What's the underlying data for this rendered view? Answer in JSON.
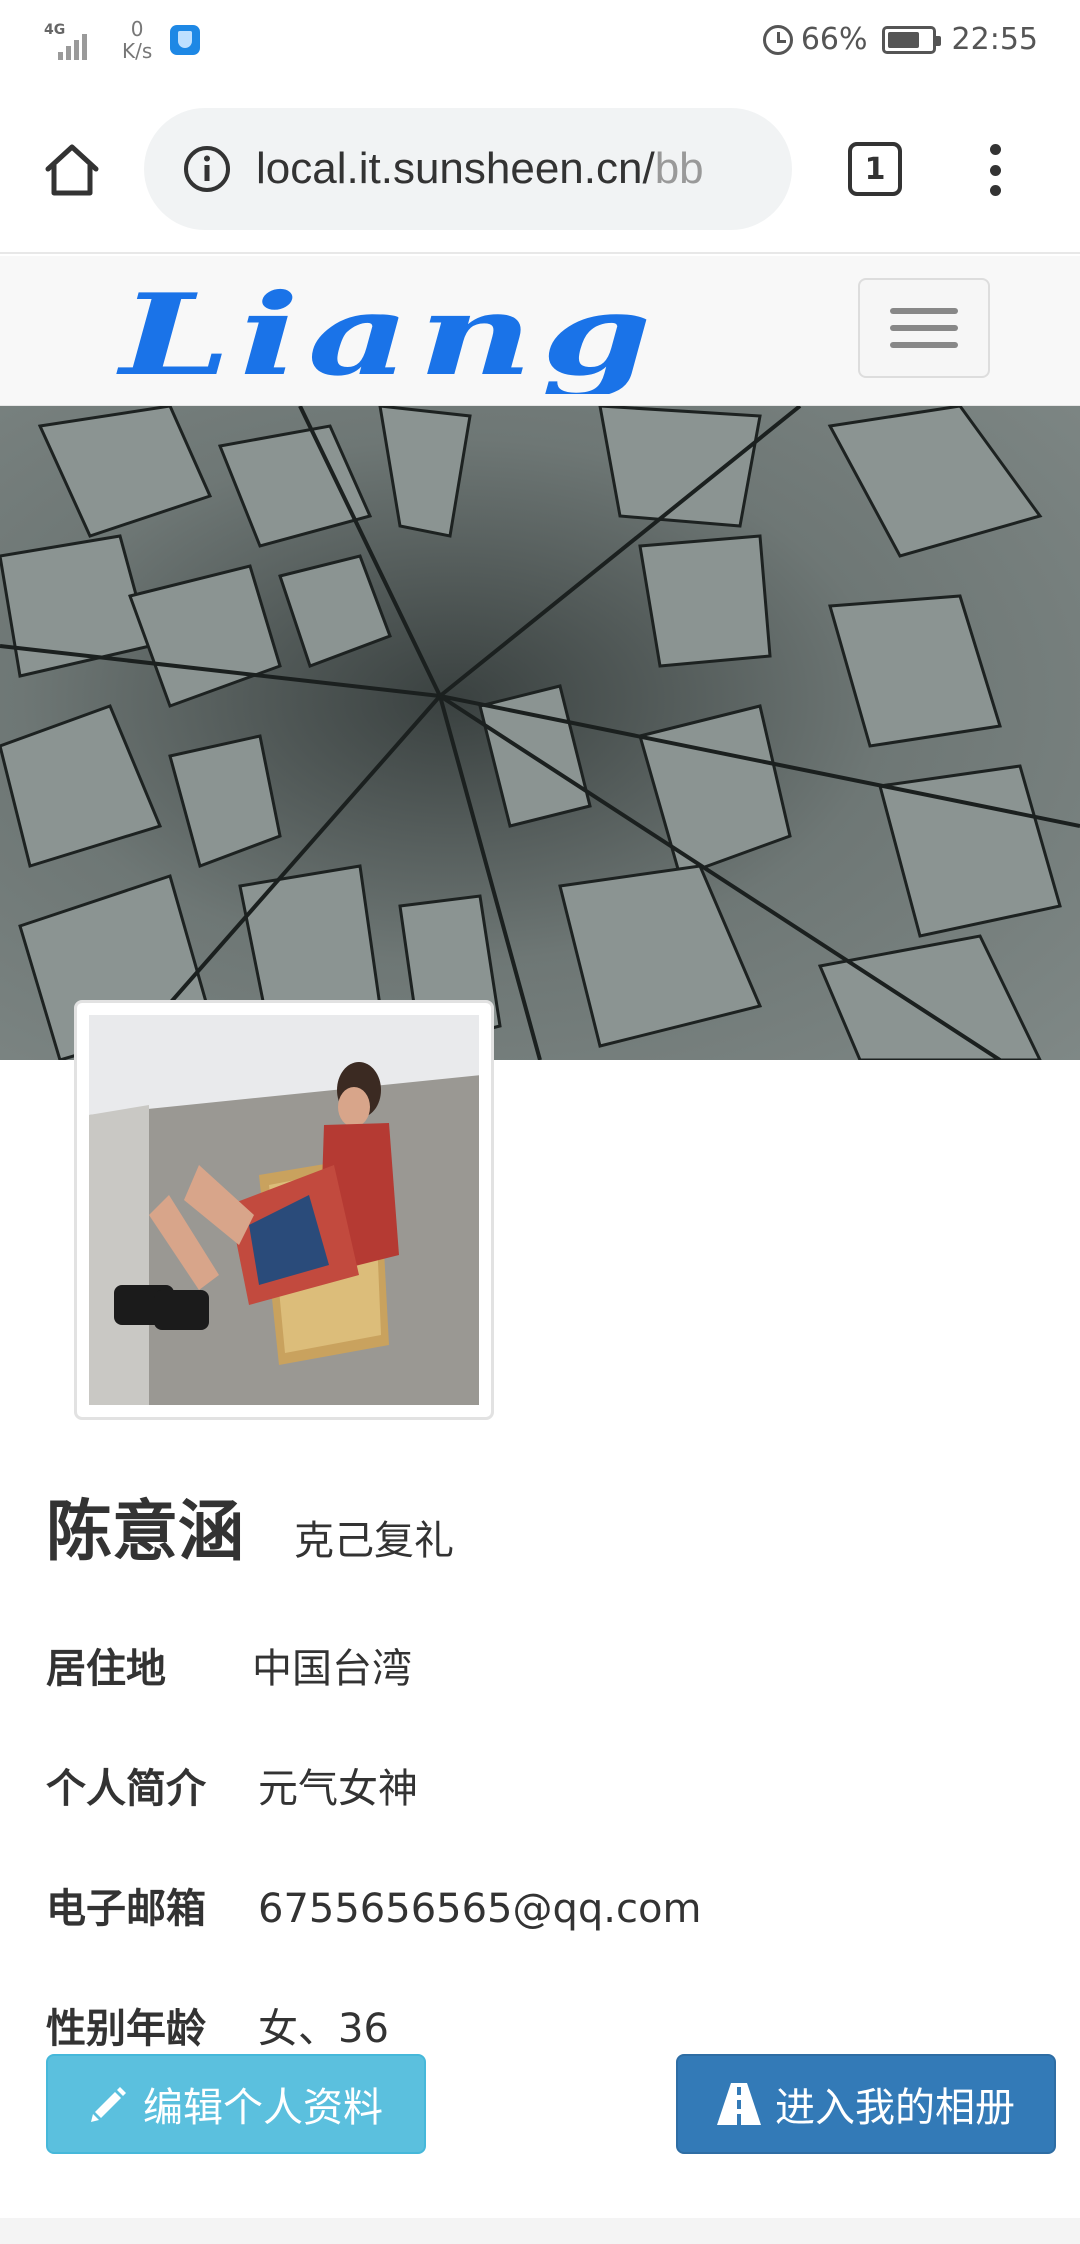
{
  "status_bar": {
    "network": "4G",
    "speed_value": "0",
    "speed_unit": "K/s",
    "battery_percent": "66%",
    "battery_level": 0.66,
    "time": "22:55"
  },
  "browser": {
    "url_main": "local.it.sunsheen.cn/",
    "url_faded": "bb",
    "tab_count": "1"
  },
  "site": {
    "logo_text": "Liang",
    "logo_color": "#1a73e8"
  },
  "profile": {
    "name": "陈意涵",
    "motto": "克己复礼",
    "rows": [
      {
        "label": "居住地",
        "value": "中国台湾"
      },
      {
        "label": "个人简介",
        "value": "元气女神"
      },
      {
        "label": "电子邮箱",
        "value": "6755656565@qq.com"
      },
      {
        "label": "性别年龄",
        "value": "女、36"
      }
    ]
  },
  "buttons": {
    "edit_label": "编辑个人资料",
    "album_label": "进入我的相册"
  },
  "colors": {
    "edit_button": "#5bc0de",
    "album_button": "#337ab7"
  }
}
